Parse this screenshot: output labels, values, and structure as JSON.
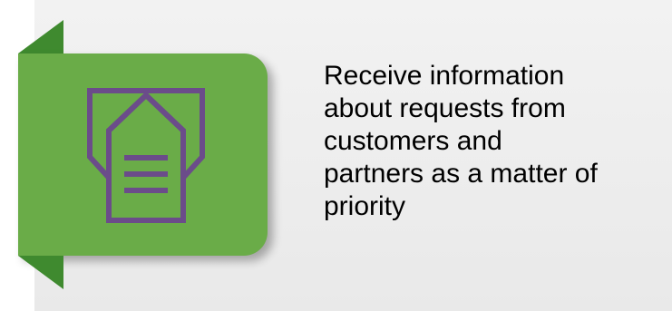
{
  "icon": {
    "name": "envelope-document-icon",
    "color": "#6b4c8a"
  },
  "colors": {
    "tile": "#6aac48",
    "fold": "#3f8a2f",
    "background": "#eeeeee",
    "text": "#000000"
  },
  "caption": {
    "line1": "Receive information",
    "line2": "about requests from",
    "line3": "customers and",
    "line4": "partners as a matter of",
    "line5": "priority"
  }
}
